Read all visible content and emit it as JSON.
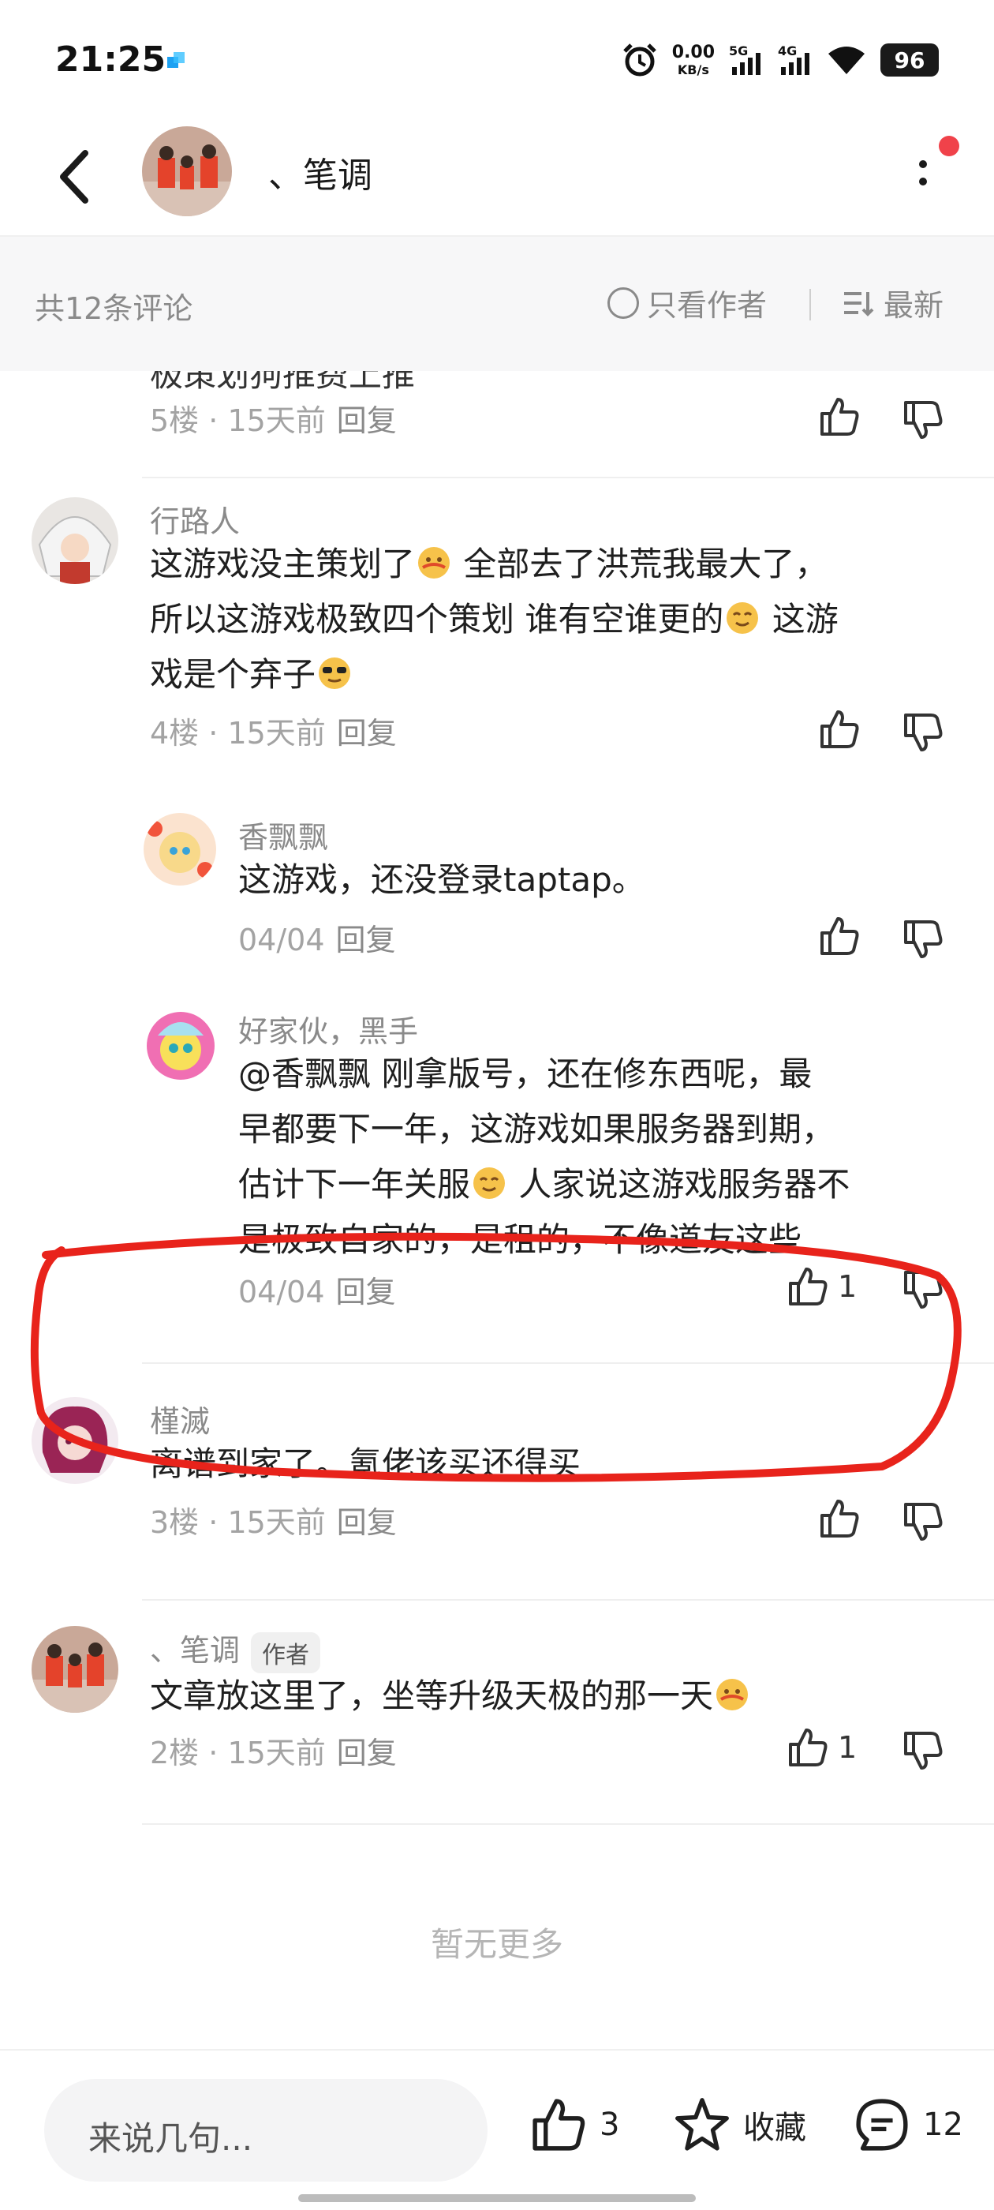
{
  "status": {
    "time": "21:25",
    "net_speed_value": "0.00",
    "net_speed_unit": "KB/s",
    "signal1": "5G",
    "signal2": "4G",
    "battery": "96"
  },
  "header": {
    "title": "、笔调"
  },
  "summary": {
    "count": "共12条评论",
    "author_only": "只看作者",
    "sort": "最新"
  },
  "comments": [
    {
      "id": "c5",
      "truncated_text": "极策划狗推费上推",
      "floor": "5楼",
      "time": "15天前",
      "reply": "回复"
    },
    {
      "id": "c4",
      "user": "行路人",
      "line1": "这游戏没主策划了",
      "line1b": " 全部去了洪荒我最大了，",
      "line2": "所以这游戏极致四个策划 谁有空谁更的",
      "line2b": " 这游",
      "line3": "戏是个弃子",
      "floor": "4楼",
      "time": "15天前",
      "reply": "回复",
      "subreplies": [
        {
          "user": "香飘飘",
          "text": "这游戏，还没登录taptap。",
          "time": "04/04",
          "reply": "回复"
        },
        {
          "user": "好家伙，黑手",
          "line1": "@香飘飘  刚拿版号，还在修东西呢，最",
          "line2": "早都要下一年，这游戏如果服务器到期，",
          "line3": "估计下一年关服",
          "line3b": " 人家说这游戏服务器不",
          "line4": "是极致自家的，是租的，不像道友这些",
          "time": "04/04",
          "reply": "回复",
          "likes": "1"
        }
      ]
    },
    {
      "id": "c3",
      "user": "槿滅",
      "text": "离谱到家了。氪佬该买还得买",
      "floor": "3楼",
      "time": "15天前",
      "reply": "回复"
    },
    {
      "id": "c2",
      "user": "、笔调",
      "tag": "作者",
      "text": "文章放这里了，坐等升级天极的那一天",
      "floor": "2楼",
      "time": "15天前",
      "reply": "回复",
      "likes": "1"
    }
  ],
  "no_more": "暂无更多",
  "bottom": {
    "input_placeholder": "来说几句...",
    "likes": "3",
    "favorite": "收藏",
    "comments": "12"
  },
  "colors": {
    "highlight": "#e8231b",
    "red_dot": "#f0424a",
    "muted_text": "#8a8a8a"
  }
}
